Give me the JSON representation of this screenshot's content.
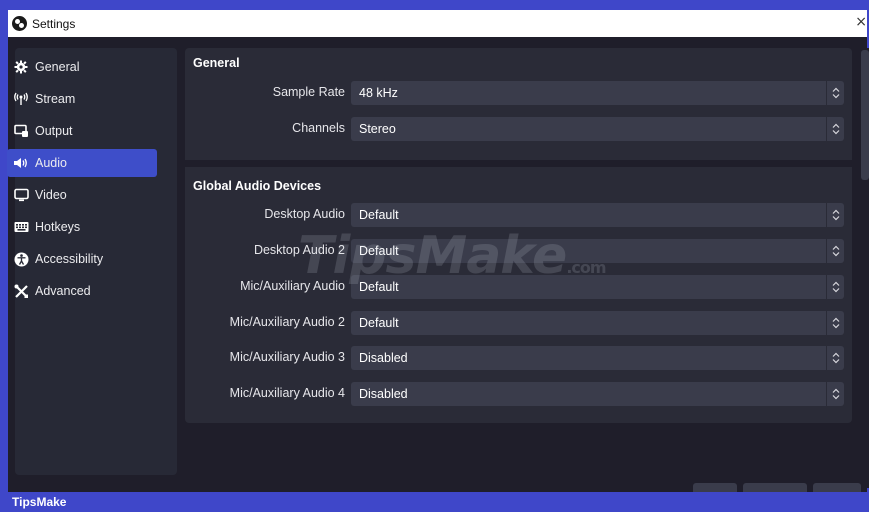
{
  "window": {
    "title": "Settings",
    "close_glyph": "×"
  },
  "sidebar": {
    "items": [
      {
        "label": "General",
        "icon": "gear-icon",
        "active": false
      },
      {
        "label": "Stream",
        "icon": "antenna-icon",
        "active": false
      },
      {
        "label": "Output",
        "icon": "output-icon",
        "active": false
      },
      {
        "label": "Audio",
        "icon": "speaker-icon",
        "active": true
      },
      {
        "label": "Video",
        "icon": "monitor-icon",
        "active": false
      },
      {
        "label": "Hotkeys",
        "icon": "keyboard-icon",
        "active": false
      },
      {
        "label": "Accessibility",
        "icon": "accessibility-icon",
        "active": false
      },
      {
        "label": "Advanced",
        "icon": "tools-icon",
        "active": false
      }
    ]
  },
  "general": {
    "title": "General",
    "sample_rate": {
      "label": "Sample Rate",
      "value": "48 kHz"
    },
    "channels": {
      "label": "Channels",
      "value": "Stereo"
    }
  },
  "devices": {
    "title": "Global Audio Devices",
    "rows": [
      {
        "label": "Desktop Audio",
        "value": "Default"
      },
      {
        "label": "Desktop Audio 2",
        "value": "Default"
      },
      {
        "label": "Mic/Auxiliary Audio",
        "value": "Default"
      },
      {
        "label": "Mic/Auxiliary Audio 2",
        "value": "Default"
      },
      {
        "label": "Mic/Auxiliary Audio 3",
        "value": "Disabled"
      },
      {
        "label": "Mic/Auxiliary Audio 4",
        "value": "Disabled"
      }
    ]
  },
  "watermark": {
    "text": "TipsMake",
    "suffix": ".com"
  },
  "footer": {
    "brand": "TipsMake"
  },
  "colors": {
    "accent": "#3e4ec9",
    "frame": "#3f47c9",
    "panel": "#2a2b37",
    "background": "#1f1e2a"
  }
}
